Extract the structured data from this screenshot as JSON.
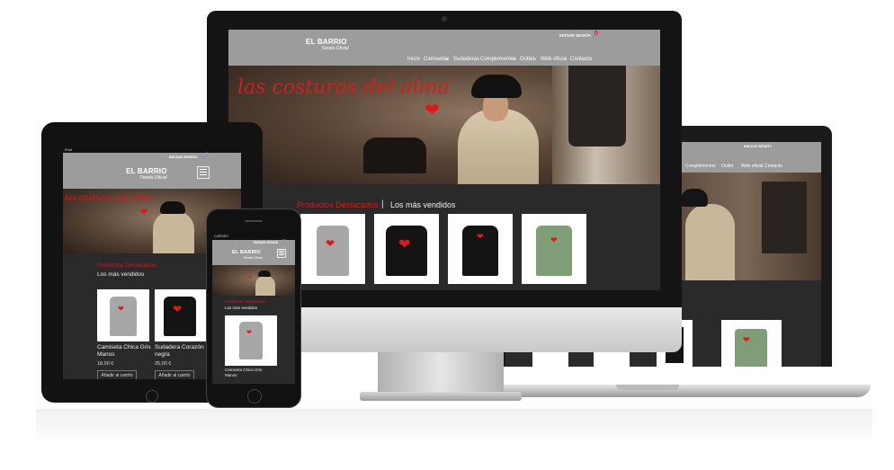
{
  "brand": {
    "name": "EL BARRIO",
    "tagline": "Tienda Oficial"
  },
  "header": {
    "login": "INICIAR SESIÓN",
    "cart_count": "0"
  },
  "nav": {
    "items": [
      "Inicio",
      "Camisetas",
      "Sudaderas",
      "Complementos",
      "Outlet",
      "Web oficial",
      "Contacto"
    ]
  },
  "laptop_nav": {
    "items": [
      "Complementos",
      "Outlet",
      "Web oficial",
      "Contacto"
    ]
  },
  "hero": {
    "script_text": "las costuras del alma"
  },
  "sections": {
    "featured": "Productos Destacados",
    "separator": "|",
    "best_sellers": "Los más vendidos"
  },
  "products": [
    {
      "name": "Camiseta Chica Gris Manos",
      "price": "18,00 €",
      "button": "Añadir al carrito"
    },
    {
      "name": "Sudadera Corazón negra",
      "price": "25,00 €",
      "button": "Añadir al carrito"
    }
  ],
  "phone": {
    "carrier": "CARRIER",
    "login": "INICIAR SESIÓN"
  },
  "tablet": {
    "status": "iPad"
  },
  "colors": {
    "accent": "#d11f1f",
    "header_bg": "#9c9c9c",
    "page_bg": "#2a2a2a"
  }
}
